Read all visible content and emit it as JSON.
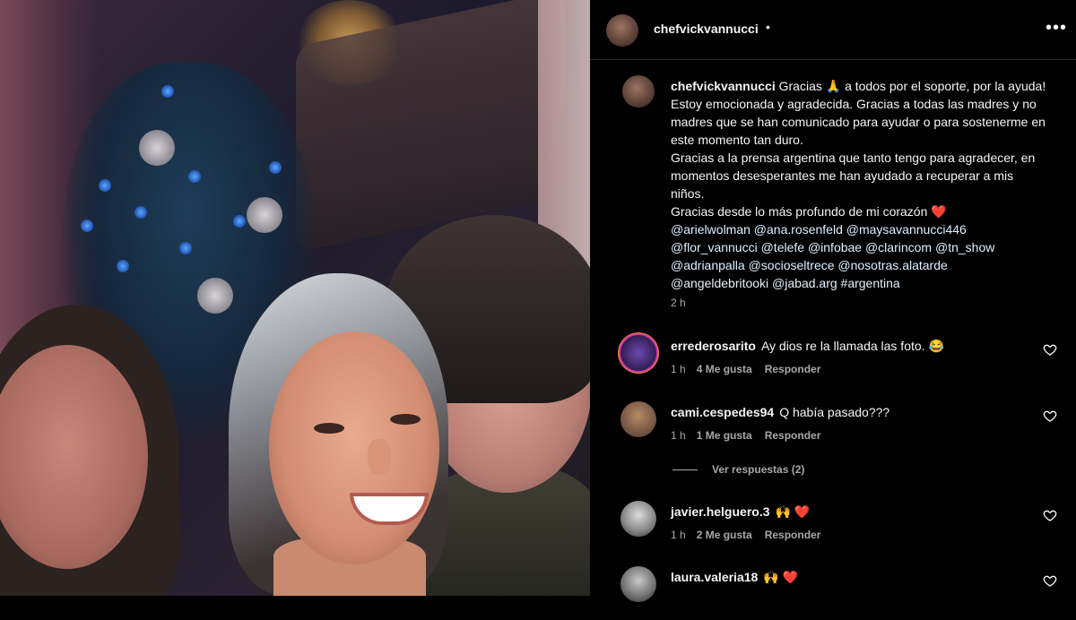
{
  "post": {
    "author": "chefvickvannucci",
    "dot": "•",
    "more_icon": "more-options-icon",
    "more_label": "•••"
  },
  "caption": {
    "author": "chefvickvannucci",
    "line1": "Gracias 🙏 a todos por el soporte, por la ayuda! Estoy emocionada y agradecida. Gracias a todas las madres y no madres que se han comunicado para ayudar o para sostenerme en este momento tan duro.",
    "line2": "Gracias a la prensa argentina que tanto tengo para agradecer, en momentos desesperantes me han ayudado a recuperar a mis niños.",
    "line3": "Gracias desde lo más profundo de mi corazón ❤️",
    "mentions": "@arielwolman @ana.rosenfeld @maysavannucci446 @flor_vannucci @telefe @infobae @clarincom @tn_show @adrianpalla @socioseltrece @nosotras.alatarde @angeldebritooki @jabad.arg #argentina",
    "time": "2 h"
  },
  "comments": [
    {
      "user": "errederosarito",
      "text": "Ay dios re la llamada las foto. 😂",
      "time": "1 h",
      "likes": "4 Me gusta",
      "reply": "Responder"
    },
    {
      "user": "cami.cespedes94",
      "text": "Q había pasado???",
      "time": "1 h",
      "likes": "1 Me gusta",
      "reply": "Responder"
    },
    {
      "user": "javier.helguero.3",
      "text": "🙌 ❤️",
      "time": "1 h",
      "likes": "2 Me gusta",
      "reply": "Responder"
    },
    {
      "user": "laura.valeria18",
      "text": "🙌 ❤️",
      "time": "",
      "likes": "",
      "reply": ""
    }
  ],
  "view_replies": "Ver respuestas (2)",
  "colors": {
    "background": "#000000",
    "text": "#f5f5f5",
    "secondary": "#a8a8a8",
    "mention": "#e0f1ff",
    "heart": "#ff3040"
  }
}
